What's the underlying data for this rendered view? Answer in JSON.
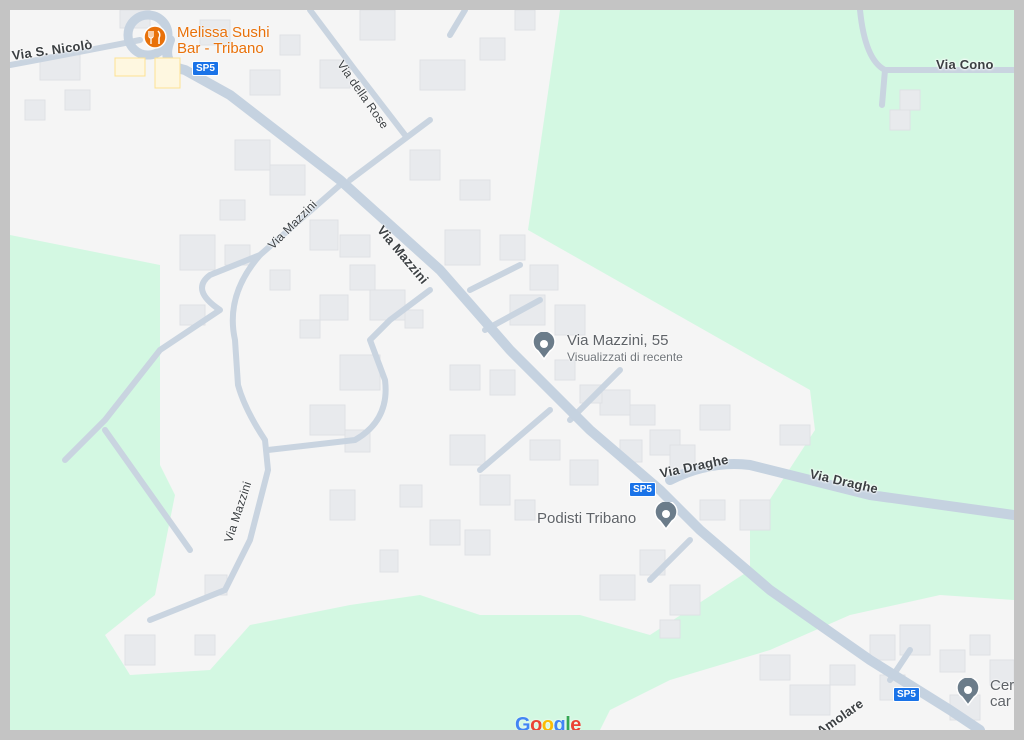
{
  "roads": {
    "via_s_nicolo": "Via S. Nicolò",
    "via_della_rose": "Via della Rose",
    "via_cono": "Via Cono",
    "via_mazzini_main": "Via Mazzini",
    "via_mazzini_upper_left": "Via Mazzini",
    "via_mazzini_lower_left": "Via Mazzini",
    "via_draghe_1": "Via Draghe",
    "via_draghe_2": "Via Draghe",
    "amolare": "Amolare"
  },
  "shields": {
    "sp5_top": "SP5",
    "sp5_middle": "SP5",
    "sp5_bottom": "SP5"
  },
  "places": {
    "restaurant": {
      "line1": "Melissa Sushi",
      "line2": "Bar - Tribano",
      "icon": "restaurant-icon"
    },
    "address": {
      "title": "Via Mazzini, 55",
      "subtitle": "Visualizzati di recente",
      "icon": "location-pin-icon"
    },
    "podisti": {
      "title": "Podisti Tribano",
      "icon": "location-pin-icon"
    },
    "cemetery": {
      "line1": "Cer",
      "line2": "car",
      "icon": "location-pin-icon"
    }
  },
  "branding": {
    "logo_text": "Google"
  },
  "colors": {
    "green_area": "#d3f8e2",
    "urban_area": "#f5f5f5",
    "road": "#c5d2e0",
    "building": "#e8eaed",
    "shield": "#1a73e8",
    "restaurant": "#e8710a",
    "pin": "#6b7c8a"
  }
}
